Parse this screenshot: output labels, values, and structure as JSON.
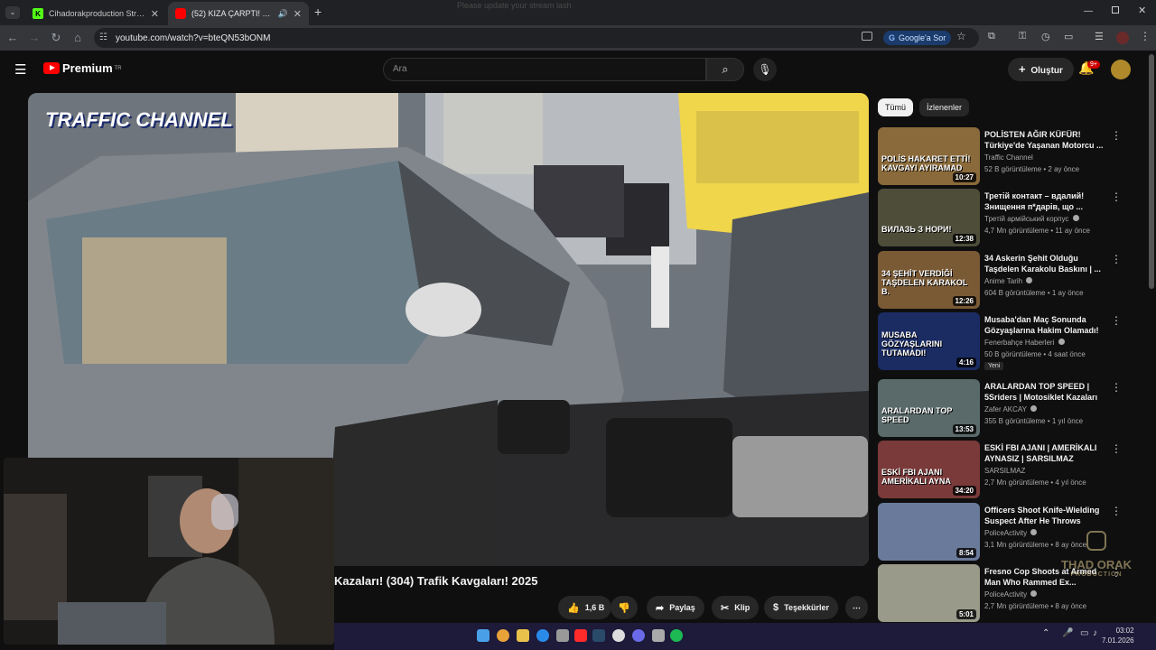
{
  "browser": {
    "tabs": [
      {
        "title": "Cihadorakproduction Stream -",
        "favicon_color": "#53fc18",
        "favicon_letter": "K",
        "active": false
      },
      {
        "title": "(52) KIZA ÇARPTI! Türkiye'd",
        "favicon_color": "#ff0000",
        "favicon_letter": "",
        "active": true
      }
    ],
    "url": "youtube.com/watch?v=bteQN53bONM",
    "google_button": "Google'a Sor",
    "top_caption": "Please update your stream lash"
  },
  "youtube": {
    "logo": "Premium",
    "logo_sup": "TR",
    "search_placeholder": "Ara",
    "create_label": "Oluştur",
    "notification_count": "9+",
    "chips": [
      "Tümü",
      "İzlenenler"
    ],
    "video_watermark": "TRAFFIC CHANNEL",
    "video_title": "Kazaları! (304) Trafik Kavgaları! 2025",
    "actions": {
      "likes": "1,6 B",
      "share": "Paylaş",
      "clip": "Klip",
      "thanks": "Teşekkürler"
    },
    "recommendations": [
      {
        "title": "POLİSTEN AĞIR KÜFÜR! Türkiye'de Yaşanan Motorcu ...",
        "channel": "Traffic Channel",
        "meta": "52 B görüntüleme • 2 ay önce",
        "duration": "10:27",
        "thumb_text": "POLİS HAKARET ETTİ! KAVGAYI AYIRAMAD",
        "thumb_color": "#8a6a3a",
        "verified": false,
        "new": false
      },
      {
        "title": "Третій контакт – вдалий! Знищення п*дарів, що ...",
        "channel": "Третій армійський корпус",
        "meta": "4,7 Mn görüntüleme • 11 ay önce",
        "duration": "12:38",
        "thumb_text": "ВИЛАЗЬ З НОРИ!",
        "thumb_color": "#4d4d3a",
        "verified": true,
        "new": false
      },
      {
        "title": "34 Askerin Şehit Olduğu Taşdelen Karakolu Baskını | ...",
        "channel": "Anime Tarih",
        "meta": "604 B görüntüleme • 1 ay önce",
        "duration": "12:26",
        "thumb_text": "34 ŞEHİT VERDİĞİ TAŞDELEN KARAKOL B.",
        "thumb_color": "#7a5a35",
        "verified": true,
        "new": false
      },
      {
        "title": "Musaba'dan Maç Sonunda Gözyaşlarına Hakim Olamadı! ...",
        "channel": "Fenerbahçe Haberleri",
        "meta": "50 B görüntüleme • 4 saat önce",
        "duration": "4:16",
        "thumb_text": "MUSABA GÖZYAŞLARINI TUTAMADI!",
        "thumb_color": "#1b2c63",
        "verified": true,
        "new": true,
        "new_label": "Yeni"
      },
      {
        "title": "ARALARDAN TOP SPEED | 5Sriders | Motosiklet Kazaları ...",
        "channel": "Zafer AKCAY",
        "meta": "355 B görüntüleme • 1 yıl önce",
        "duration": "13:53",
        "thumb_text": "ARALARDAN TOP SPEED",
        "thumb_color": "#5a6a6a",
        "verified": true,
        "new": false
      },
      {
        "title": "ESKİ FBI AJANI | AMERİKALI AYNASIZ | SARSILMAZ",
        "channel": "SARSILMAZ",
        "meta": "2,7 Mn görüntüleme • 4 yıl önce",
        "duration": "34:20",
        "thumb_text": "ESKİ FBI AJANI AMERİKALI AYNA",
        "thumb_color": "#7a3a3a",
        "verified": false,
        "new": false
      },
      {
        "title": "Officers Shoot Knife-Wielding Suspect After He Throws Wine...",
        "channel": "PoliceActivity",
        "meta": "3,1 Mn görüntüleme • 8 ay önce",
        "duration": "8:54",
        "thumb_text": "",
        "thumb_color": "#6a7a9a",
        "verified": true,
        "new": false
      },
      {
        "title": "Fresno Cop Shoots at Armed Man Who Rammed Ex...",
        "channel": "PoliceActivity",
        "meta": "2,7 Mn görüntüleme • 8 ay önce",
        "duration": "5:01",
        "thumb_text": "",
        "thumb_color": "#9a9a8a",
        "verified": true,
        "new": false
      }
    ]
  },
  "overlay": {
    "watermark_name": "THAD ORAK",
    "watermark_sub": "PRODUCTION"
  },
  "taskbar": {
    "time": "03:02",
    "date": "7.01.2026"
  }
}
